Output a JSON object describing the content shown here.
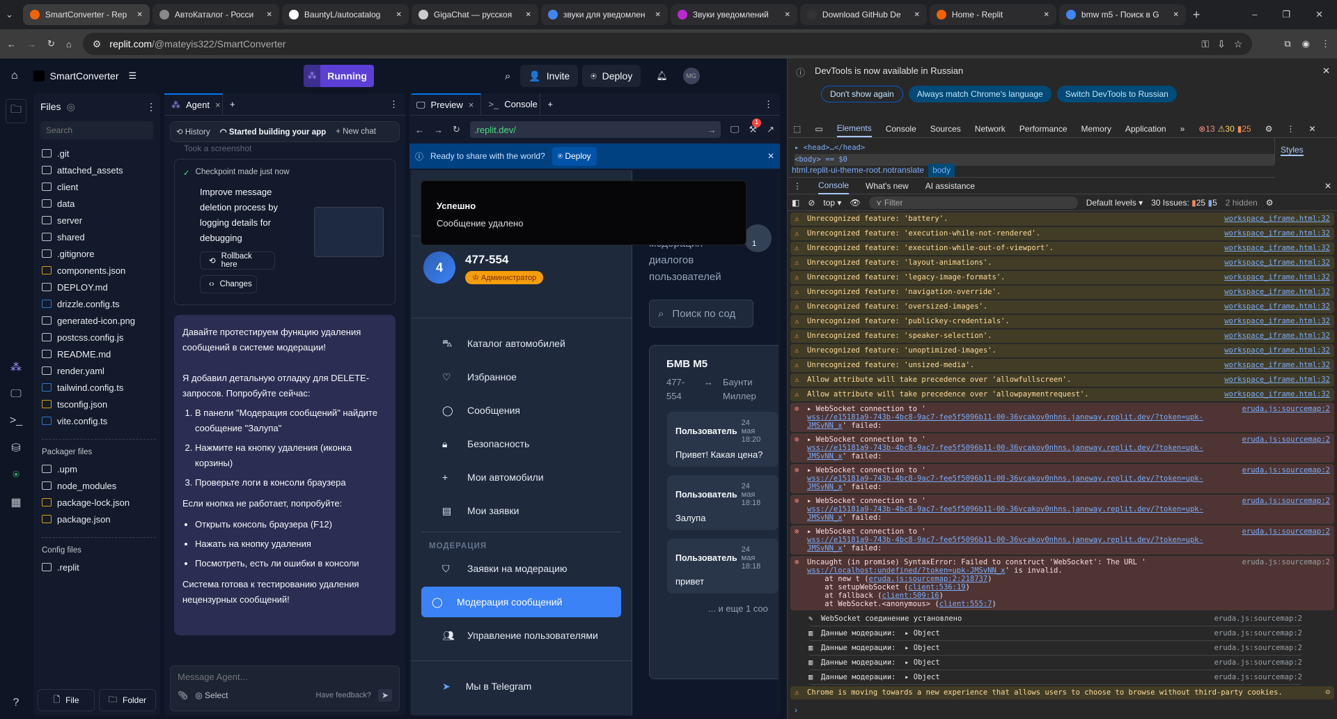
{
  "browser": {
    "tabs": [
      "SmartConverter - Rep",
      "АвтоКаталог - Росси",
      "BauntyL/autocatalog",
      "GigaChat — русскоя",
      "звуки для уведомлен",
      "Звуки уведомлений",
      "Download GitHub De",
      "Home - Replit",
      "bmw m5 - Поиск в G"
    ],
    "url_host": "replit.com",
    "url_path": "/@mateyis322/SmartConverter"
  },
  "replit": {
    "project": "SmartConverter",
    "running": "Running",
    "invite": "Invite",
    "deploy": "Deploy",
    "avatar": "MG",
    "files_title": "Files",
    "search_placeholder": "Search",
    "files": [
      ".git",
      "attached_assets",
      "client",
      "data",
      "server",
      "shared",
      ".gitignore",
      "components.json",
      "DEPLOY.md",
      "drizzle.config.ts",
      "generated-icon.png",
      "postcss.config.js",
      "README.md",
      "render.yaml",
      "tailwind.config.ts",
      "tsconfig.json",
      "vite.config.ts"
    ],
    "packager_title": "Packager files",
    "packager": [
      ".upm",
      "node_modules",
      "package-lock.json",
      "package.json"
    ],
    "config_title": "Config files",
    "config": [
      ".replit"
    ],
    "new_file": "File",
    "new_folder": "Folder"
  },
  "agent": {
    "tab": "Agent",
    "history": "History",
    "status": "Started building your app",
    "new_chat": "New chat",
    "screenshot": "Took a screenshot",
    "checkpoint": "Checkpoint made just now",
    "checkpoint_title": "Improve message deletion process by logging details for debugging",
    "rollback": "Rollback here",
    "changes": "Changes",
    "message": {
      "p1": "Давайте протестируем функцию удаления сообщений в системе модерации!",
      "p2": "Я добавил детальную отладку для DELETE-запросов. Попробуйте сейчас:",
      "steps": [
        "В панели \"Модерация сообщений\" найдите сообщение \"Залупа\"",
        "Нажмите на кнопку удаления (иконка корзины)",
        "Проверьте логи в консоли браузера"
      ],
      "p3": "Если кнопка не работает, попробуйте:",
      "bullets": [
        "Открыть консоль браузера (F12)",
        "Нажать на кнопку удаления",
        "Посмотреть, есть ли ошибки в консоли"
      ],
      "p4": "Система готова к тестированию удаления нецензурных сообщений!"
    },
    "input_placeholder": "Message Agent...",
    "select": "Select",
    "feedback": "Have feedback?"
  },
  "preview": {
    "tab": "Preview",
    "console_tab": "Console",
    "url": ".replit.dev/",
    "banner": "Ready to share with the world?",
    "banner_deploy": "Deploy",
    "badge": "1"
  },
  "app": {
    "toast_title": "Успешно",
    "toast_text": "Сообщение удалено",
    "avatar": "4",
    "user": "477-554",
    "role": "Администратор",
    "nav": [
      "Каталог автомобилей",
      "Избранное",
      "Сообщения",
      "Безопасность",
      "Мои автомобили",
      "Мои заявки"
    ],
    "mod_title": "МОДЕРАЦИЯ",
    "mod_nav": [
      "Заявки на модерацию",
      "Модерация сообщений",
      "Управление пользователями"
    ],
    "telegram": "Мы в Telegram",
    "subtitle": "модерация диалогов пользователей",
    "search": "Поиск по сод",
    "count": "1",
    "chat_title": "БМВ М5",
    "from": "477-554",
    "to": "Баунти Миллер",
    "messages": [
      {
        "author": "Пользователь",
        "date": "24 мая 18:20",
        "text": "Привет! Какая цена?"
      },
      {
        "author": "Пользователь",
        "date": "24 мая 18:18",
        "text": "Залупа"
      },
      {
        "author": "Пользователь",
        "date": "24 мая 18:18",
        "text": "привет"
      }
    ],
    "more": "... и еще 1 соо"
  },
  "devtools": {
    "info": "DevTools is now available in Russian",
    "btn1": "Don't show again",
    "btn2": "Always match Chrome's language",
    "btn3": "Switch DevTools to Russian",
    "tabs": [
      "Elements",
      "Console",
      "Sources",
      "Network",
      "Performance",
      "Memory",
      "Application"
    ],
    "errors": "13",
    "warnings": "30",
    "issues_count": "25",
    "head": "<head>",
    "head_close": "</head>",
    "body": "<body> == $0",
    "crumb1": "html.replit-ui-theme-root.notranslate",
    "crumb2": "body",
    "styles": "Styles",
    "drawer_tabs": [
      "Console",
      "What's new",
      "AI assistance"
    ],
    "context": "top",
    "filter": "Filter",
    "levels": "Default levels",
    "issues": "30 Issues:",
    "issues_w": "25",
    "issues_i": "5",
    "hidden": "2 hidden",
    "warnings_list": [
      "Unrecognized feature: 'battery'.",
      "Unrecognized feature: 'execution-while-not-rendered'.",
      "Unrecognized feature: 'execution-while-out-of-viewport'.",
      "Unrecognized feature: 'layout-animations'.",
      "Unrecognized feature: 'legacy-image-formats'.",
      "Unrecognized feature: 'navigation-override'.",
      "Unrecognized feature: 'oversized-images'.",
      "Unrecognized feature: 'publickey-credentials'.",
      "Unrecognized feature: 'speaker-selection'.",
      "Unrecognized feature: 'unoptimized-images'.",
      "Unrecognized feature: 'unsized-media'.",
      "Allow attribute will take precedence over 'allowfullscreen'.",
      "Allow attribute will take precedence over 'allowpaymentrequest'."
    ],
    "warn_source": "workspace_iframe.html:32",
    "ws_error": "WebSocket connection to '",
    "ws_url": "wss://e15181a9-743b-4bc8-9ac7-fee5f5096b11-00-36vcakov0nhns.janeway.replit.dev/?token=upk-JMSvNN_x",
    "ws_failed": "' failed:",
    "ws_count": 5,
    "err_source": "eruda.js:sourcemap:2",
    "uncaught": "Uncaught (in promise) SyntaxError: Failed to construct 'WebSocket': The URL '",
    "uncaught_url": "wss://localhost:undefined/?token=upk-JMSvNN_x",
    "uncaught_end": "' is invalid.",
    "stack": [
      [
        "at new t (",
        "eruda.js:sourcemap:2:218737",
        ")"
      ],
      [
        "at setupWebSocket (",
        "client:536:19",
        ")"
      ],
      [
        "at fallback (",
        "client:509:16",
        ")"
      ],
      [
        "at WebSocket.<anonymous> (",
        "client:555:7",
        ")"
      ]
    ],
    "log_ws": "WebSocket соединение установлено",
    "log_data": "Данные модерации:",
    "log_obj": "Object",
    "log_data_count": 4,
    "cookie_warn": "Chrome is moving towards a new experience that allows users to choose to browse without third-party cookies."
  }
}
